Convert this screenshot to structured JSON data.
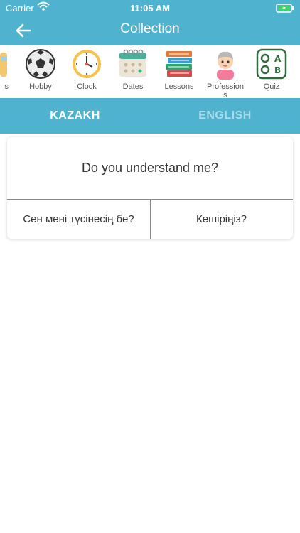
{
  "status": {
    "carrier": "Carrier",
    "time": "11:05 AM"
  },
  "header": {
    "title": "Collection",
    "back_icon": "back-arrow-icon"
  },
  "categories": [
    {
      "label": "s",
      "icon": "partial-icon"
    },
    {
      "label": "Hobby",
      "icon": "soccer-ball-icon"
    },
    {
      "label": "Clock",
      "icon": "clock-icon"
    },
    {
      "label": "Dates",
      "icon": "calendar-icon"
    },
    {
      "label": "Lessons",
      "icon": "books-icon"
    },
    {
      "label": "Profession s",
      "icon": "person-icon"
    },
    {
      "label": "Quiz",
      "icon": "quiz-icon"
    }
  ],
  "tabs": {
    "kazakh": "KAZAKH",
    "english": "ENGLISH"
  },
  "question": "Do you understand me?",
  "options": [
    "Сен мені түсінесің бе?",
    "Кешіріңіз?"
  ],
  "colors": {
    "accent": "#4fb3cf",
    "tab_inactive": "#a9dcea"
  }
}
